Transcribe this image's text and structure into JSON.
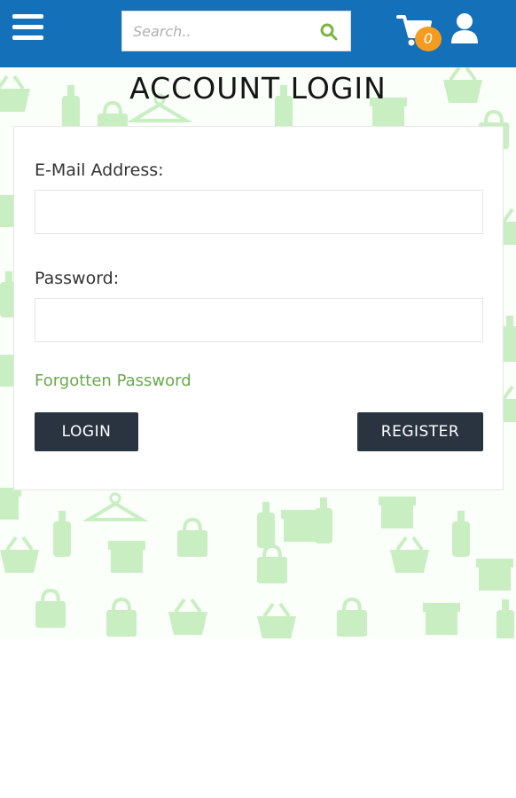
{
  "header": {
    "search_placeholder": "Search..",
    "cart_count": "0"
  },
  "page": {
    "title": "ACCOUNT LOGIN"
  },
  "form": {
    "email_label": "E-Mail Address:",
    "email_value": "",
    "password_label": "Password:",
    "password_value": "",
    "forgot_label": "Forgotten Password",
    "login_label": "LOGIN",
    "register_label": "REGISTER"
  },
  "colors": {
    "header_bg": "#1470b8",
    "badge": "#f39c1f",
    "button_bg": "#2a3440",
    "link_green": "#6aa84f",
    "pattern_green": "#c9eec2"
  },
  "icons": [
    "menu-icon",
    "search-icon",
    "cart-icon",
    "user-icon"
  ]
}
